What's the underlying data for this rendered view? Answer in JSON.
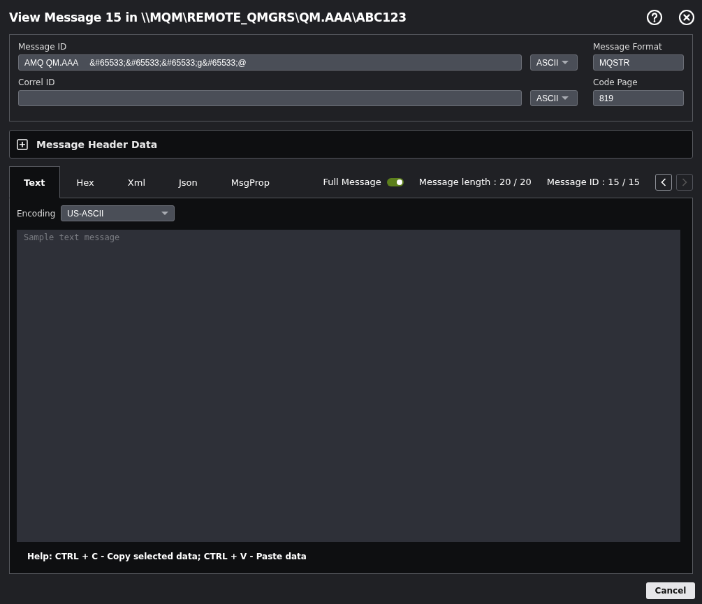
{
  "window": {
    "title": "View Message 15 in \\\\MQM\\REMOTE_QMGRS\\QM.AAA\\ABC123"
  },
  "fields": {
    "message_id": {
      "label": "Message ID",
      "value": "AMQ QM.AAA     &#65533;&#65533;&#65533;g&#65533;@",
      "encoding": "ASCII"
    },
    "correl_id": {
      "label": "Correl ID",
      "encoding": "ASCII"
    },
    "message_format": {
      "label": "Message Format",
      "value": "MQSTR"
    },
    "code_page": {
      "label": "Code Page",
      "value": "819"
    }
  },
  "header_section": {
    "title": "Message Header Data",
    "expanded": false
  },
  "tabs": [
    {
      "label": "Text",
      "selected": true
    },
    {
      "label": "Hex",
      "selected": false
    },
    {
      "label": "Xml",
      "selected": false
    },
    {
      "label": "Json",
      "selected": false
    },
    {
      "label": "MsgProp",
      "selected": false
    }
  ],
  "full_message": {
    "label": "Full Message",
    "on": true
  },
  "message_length": "Message length : 20 / 20",
  "message_position": "Message ID : 15 / 15",
  "nav": {
    "previous_disabled": false,
    "next_disabled": true
  },
  "encoding": {
    "label": "Encoding",
    "value": "US-ASCII"
  },
  "body": {
    "placeholder": "Sample text message"
  },
  "help": "Help: CTRL + C - Copy selected data; CTRL + V - Paste data",
  "buttons": [
    "Cancel"
  ]
}
